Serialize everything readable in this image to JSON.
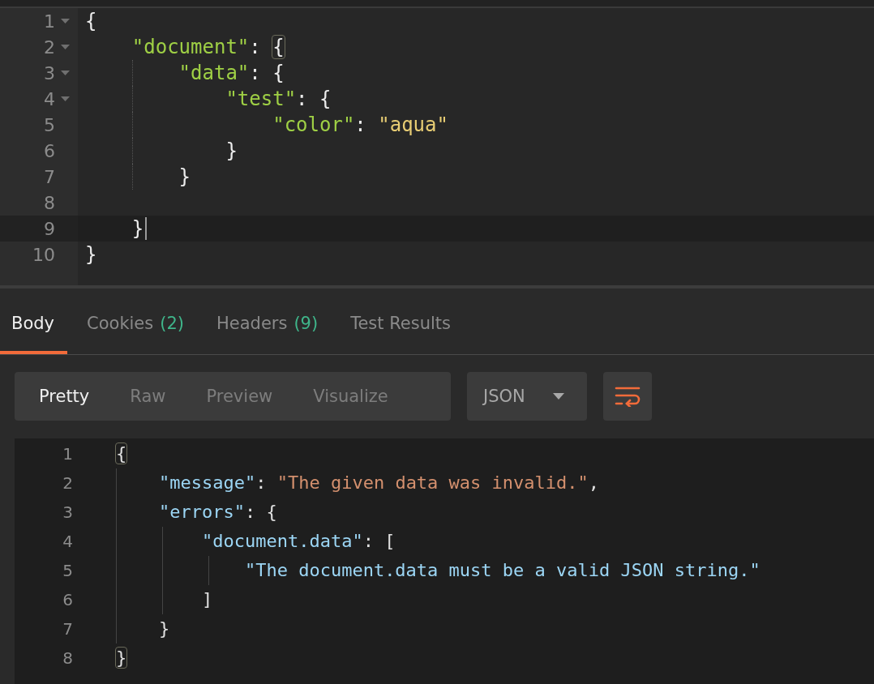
{
  "request_editor": {
    "lines": [
      {
        "number": "1",
        "foldable": true,
        "active": false,
        "tokens": [
          {
            "kind": "punct",
            "text": "{"
          }
        ]
      },
      {
        "number": "2",
        "foldable": true,
        "active": false,
        "tokens": [
          {
            "kind": "name",
            "text": "    \"document\""
          },
          {
            "kind": "punct",
            "text": ": "
          },
          {
            "kind": "punct",
            "text": "{",
            "matched": true
          }
        ]
      },
      {
        "number": "3",
        "foldable": true,
        "active": false,
        "tokens": [
          {
            "kind": "name",
            "text": "        \"data\""
          },
          {
            "kind": "punct",
            "text": ": {"
          }
        ]
      },
      {
        "number": "4",
        "foldable": true,
        "active": false,
        "tokens": [
          {
            "kind": "name",
            "text": "            \"test\""
          },
          {
            "kind": "punct",
            "text": ": {"
          }
        ]
      },
      {
        "number": "5",
        "foldable": false,
        "active": false,
        "tokens": [
          {
            "kind": "name",
            "text": "                \"color\""
          },
          {
            "kind": "punct",
            "text": ": "
          },
          {
            "kind": "value",
            "text": "\"aqua\""
          }
        ]
      },
      {
        "number": "6",
        "foldable": false,
        "active": false,
        "tokens": [
          {
            "kind": "punct",
            "text": "            }"
          }
        ]
      },
      {
        "number": "7",
        "foldable": false,
        "active": false,
        "tokens": [
          {
            "kind": "punct",
            "text": "        }"
          }
        ]
      },
      {
        "number": "8",
        "foldable": false,
        "active": false
      },
      {
        "number": "9",
        "foldable": false,
        "active": true,
        "tokens": [
          {
            "kind": "punct",
            "text": "    }"
          }
        ]
      },
      {
        "number": "10",
        "foldable": false,
        "active": false,
        "tokens": [
          {
            "kind": "punct",
            "text": "}"
          }
        ]
      }
    ]
  },
  "response_tabs": [
    {
      "label": "Body",
      "selected": true
    },
    {
      "label": "Cookies",
      "count": "(2)",
      "selected": false
    },
    {
      "label": "Headers",
      "count": "(9)",
      "selected": false
    },
    {
      "label": "Test Results",
      "selected": false
    }
  ],
  "view_modes": [
    {
      "label": "Pretty",
      "selected": true
    },
    {
      "label": "Raw",
      "selected": false
    },
    {
      "label": "Preview",
      "selected": false
    },
    {
      "label": "Visualize",
      "selected": false
    }
  ],
  "format_dropdown": {
    "value": "JSON"
  },
  "wrap_button": {
    "active": true
  },
  "response_body": {
    "lines": [
      {
        "number": "1",
        "tokens": [
          {
            "kind": "punct",
            "text": "{",
            "matched": true
          }
        ]
      },
      {
        "number": "2",
        "tokens": [
          {
            "kind": "name",
            "text": "    \"message\""
          },
          {
            "kind": "punct",
            "text": ": "
          },
          {
            "kind": "value",
            "text": "\"The given data was invalid.\""
          },
          {
            "kind": "punct",
            "text": ","
          }
        ]
      },
      {
        "number": "3",
        "tokens": [
          {
            "kind": "name",
            "text": "    \"errors\""
          },
          {
            "kind": "punct",
            "text": ": {"
          }
        ]
      },
      {
        "number": "4",
        "tokens": [
          {
            "kind": "name",
            "text": "        \"document.data\""
          },
          {
            "kind": "punct",
            "text": ": ["
          }
        ]
      },
      {
        "number": "5",
        "tokens": [
          {
            "kind": "item",
            "text": "            \"The document.data must be a valid JSON string.\""
          }
        ]
      },
      {
        "number": "6",
        "tokens": [
          {
            "kind": "punct",
            "text": "        ]"
          }
        ]
      },
      {
        "number": "7",
        "tokens": [
          {
            "kind": "punct",
            "text": "    }"
          }
        ]
      },
      {
        "number": "8",
        "tokens": [
          {
            "kind": "punct",
            "text": "}",
            "matched": true
          }
        ]
      }
    ]
  }
}
